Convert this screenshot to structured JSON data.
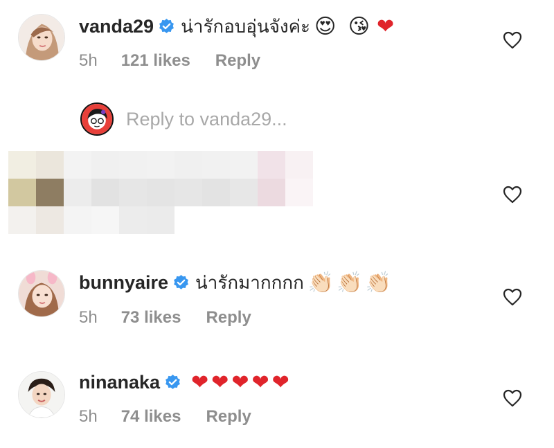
{
  "comments": [
    {
      "username": "vanda29",
      "text": "น่ารักอบอุ่นจังค่ะ",
      "emojis": "😍 😘",
      "heart": "❤",
      "time": "5h",
      "likes": "121 likes",
      "reply": "Reply"
    },
    {
      "username": "bunnyaire",
      "text": "น่ารักมากกกก",
      "emojis": "👏🏻👏🏻👏🏻",
      "time": "5h",
      "likes": "73 likes",
      "reply": "Reply"
    },
    {
      "username": "ninanaka",
      "hearts": "❤❤❤❤❤",
      "time": "5h",
      "likes": "74 likes",
      "reply": "Reply"
    }
  ],
  "reply_box": {
    "placeholder": "Reply to vanda29..."
  },
  "colors": {
    "verified": "#3897f0",
    "muted": "#8e8e8e",
    "text": "#262626",
    "heart": "#e0242b"
  },
  "icons": {
    "verified": "verified-badge-icon",
    "like": "heart-outline-icon"
  }
}
